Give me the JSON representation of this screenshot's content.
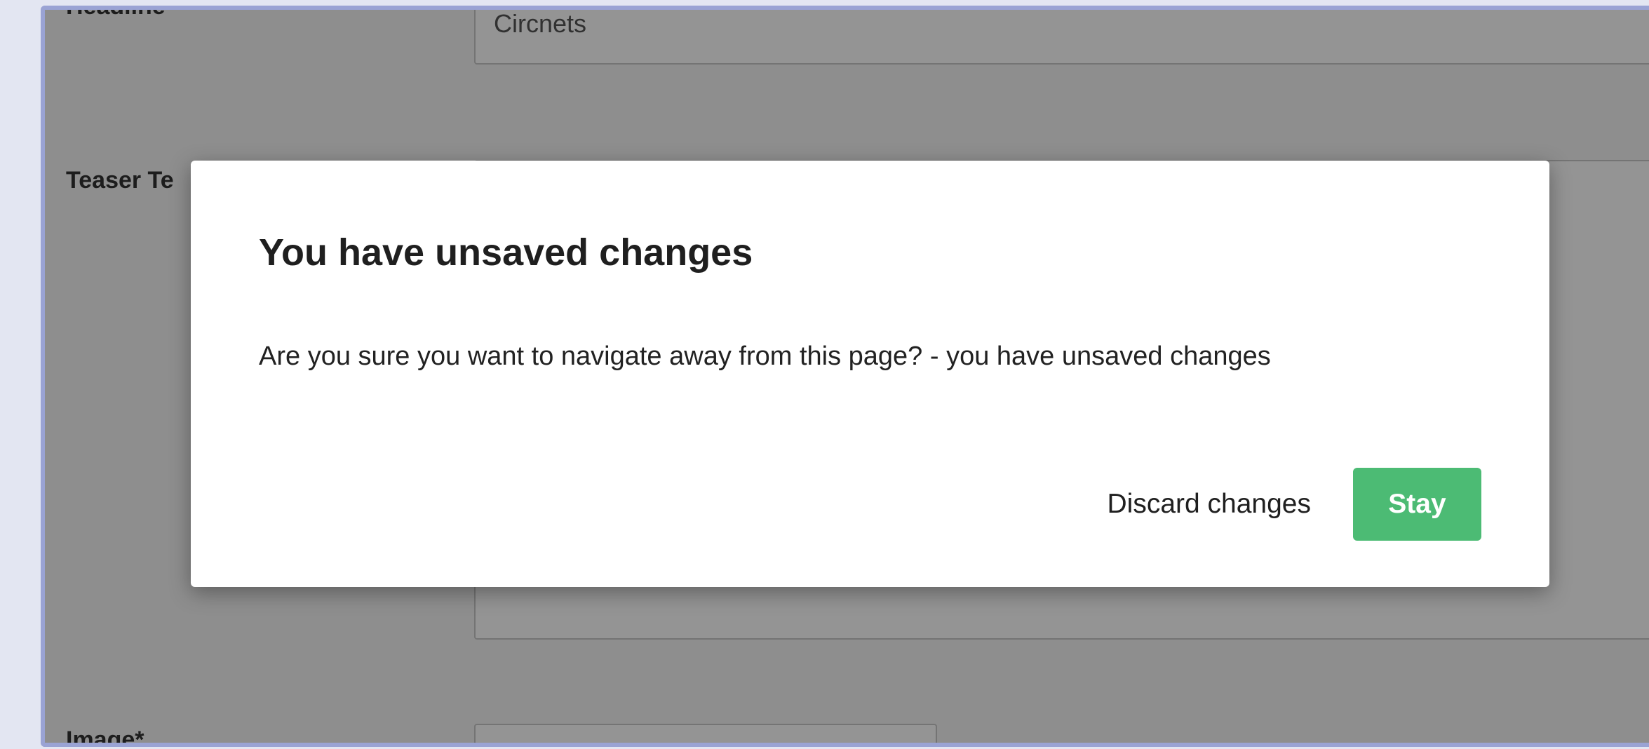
{
  "form": {
    "headline_label": "Headline",
    "headline_value": "Circnets",
    "teaser_label": "Teaser Te",
    "image_label": "Image*"
  },
  "dialog": {
    "title": "You have unsaved changes",
    "message": "Are you sure you want to navigate away from this page? - you have unsaved changes",
    "discard_label": "Discard changes",
    "stay_label": "Stay"
  },
  "colors": {
    "primary_button": "#4cbb74",
    "frame_border": "#9aa3d4"
  }
}
